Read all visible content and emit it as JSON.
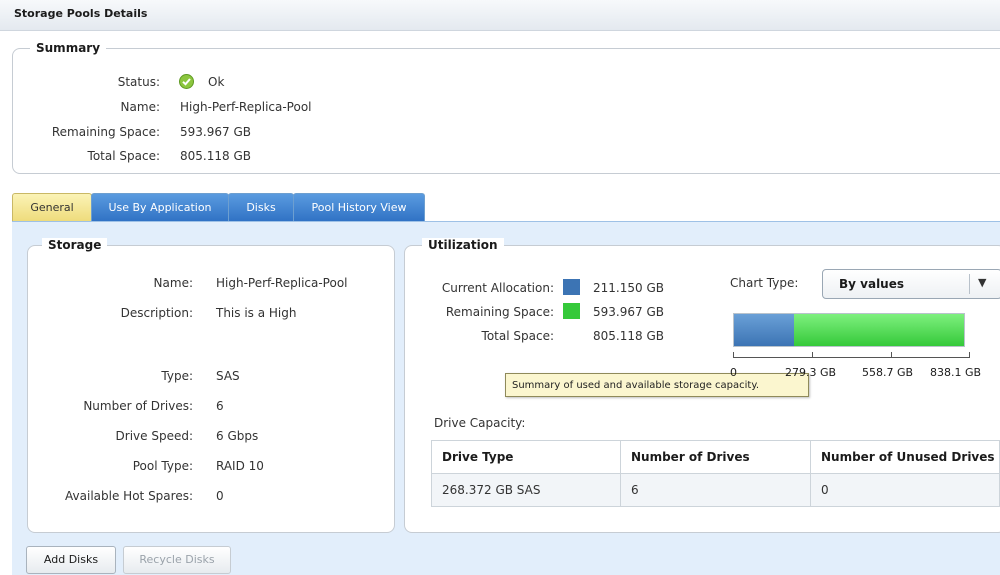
{
  "title": "Storage Pools Details",
  "summary": {
    "legend": "Summary",
    "status_label": "Status:",
    "status_value": "Ok",
    "name_label": "Name:",
    "name_value": "High-Perf-Replica-Pool",
    "remaining_label": "Remaining Space:",
    "remaining_value": "593.967 GB",
    "total_label": "Total Space:",
    "total_value": "805.118 GB"
  },
  "tabs": [
    {
      "label": "General",
      "active": true
    },
    {
      "label": "Use By Application",
      "active": false
    },
    {
      "label": "Disks",
      "active": false
    },
    {
      "label": "Pool History View",
      "active": false
    }
  ],
  "storage": {
    "legend": "Storage",
    "name_label": "Name:",
    "name_value": "High-Perf-Replica-Pool",
    "desc_label": "Description:",
    "desc_value": "This is a High",
    "type_label": "Type:",
    "type_value": "SAS",
    "drives_label": "Number of Drives:",
    "drives_value": "6",
    "speed_label": "Drive Speed:",
    "speed_value": "6 Gbps",
    "pooltype_label": "Pool Type:",
    "pooltype_value": "RAID 10",
    "spares_label": "Available Hot Spares:",
    "spares_value": "0"
  },
  "utilization": {
    "legend": "Utilization",
    "current_label": "Current Allocation:",
    "current_value": "211.150 GB",
    "remaining_label": "Remaining Space:",
    "remaining_value": "593.967 GB",
    "total_label": "Total Space:",
    "total_value": "805.118 GB",
    "chart_type_label": "Chart Type:",
    "chart_type_selected": "By values",
    "used_fraction": 0.262,
    "axis_ticks": [
      "0",
      "279.3 GB",
      "558.7 GB",
      "838.1 GB"
    ],
    "tooltip": "Summary of used and available storage capacity.",
    "drive_capacity_label": "Drive Capacity:",
    "table": {
      "headers": [
        "Drive Type",
        "Number of Drives",
        "Number of Unused Drives"
      ],
      "rows": [
        [
          "268.372 GB SAS",
          "6",
          "0"
        ]
      ]
    },
    "colors": {
      "used": "#3c74b4",
      "free": "#35c93a"
    }
  },
  "buttons": {
    "add_disks": "Add Disks",
    "recycle_disks": "Recycle Disks"
  }
}
